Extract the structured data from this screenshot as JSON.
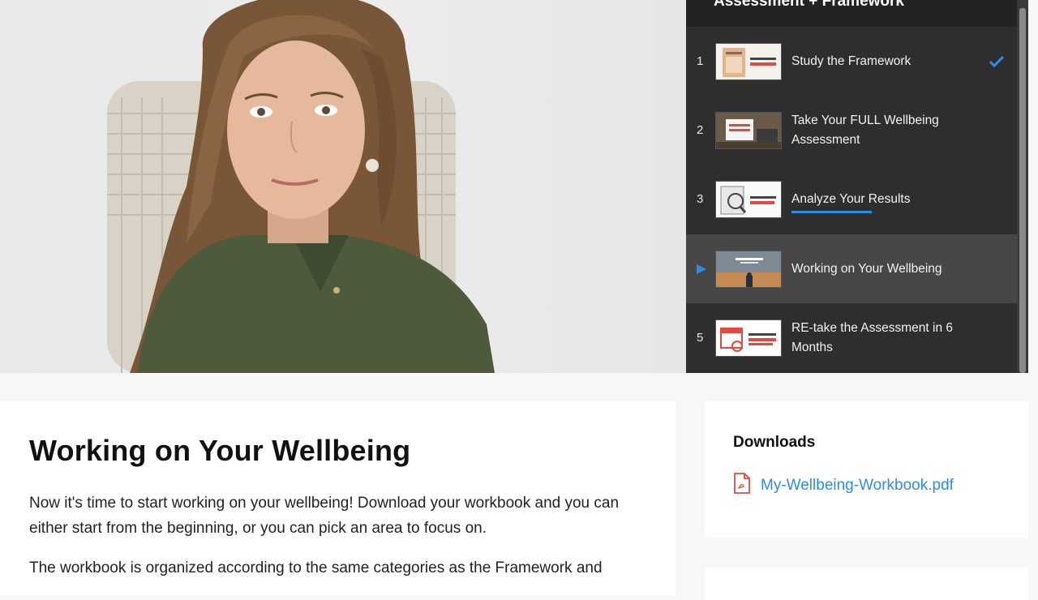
{
  "playlist": {
    "header": "Assessment + Framework",
    "items": [
      {
        "number": "1",
        "title": "Study the Framework",
        "status": "completed",
        "thumb_text": "STUDY THE FRAMEWORK"
      },
      {
        "number": "2",
        "title": "Take Your FULL Wellbeing Assessment",
        "status": "",
        "thumb_text": "MY WELLBEING ASSESSMENT"
      },
      {
        "number": "3",
        "title": "Analyze Your Results",
        "status": "in-progress",
        "progress": 0.45,
        "thumb_text": "ANALYZE YOUR RESULTS"
      },
      {
        "number": "4",
        "title": "Working on Your Wellbeing",
        "status": "playing",
        "thumb_text": "MY WELLBEING WORKBOOK"
      },
      {
        "number": "5",
        "title": "RE-take the Assessment in 6 Months",
        "status": "",
        "thumb_text": "RE-TAKE THE ASSESSMENT IN 6 MONTHS"
      }
    ]
  },
  "lesson": {
    "title": "Working on Your Wellbeing",
    "paragraph1": "Now it's time to start working on your wellbeing! Download your workbook and you can either start from the beginning, or you can pick an area to focus on.",
    "paragraph2": "The workbook is organized according to the same categories as the Framework and"
  },
  "downloads": {
    "heading": "Downloads",
    "file": "My-Wellbeing-Workbook.pdf"
  },
  "colors": {
    "accent": "#2d8ce8",
    "playlist_bg": "#2e2e2e",
    "active_bg": "#474747"
  }
}
